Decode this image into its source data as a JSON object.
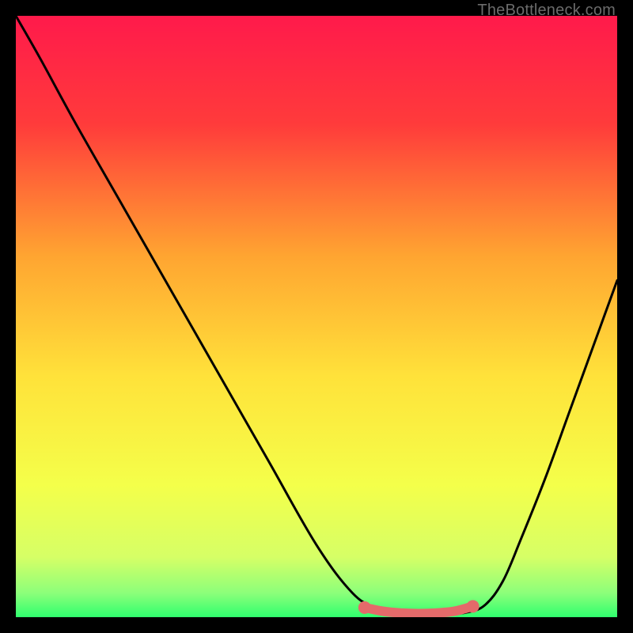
{
  "watermark": "TheBottleneck.com",
  "chart_data": {
    "type": "line",
    "title": "",
    "xlabel": "",
    "ylabel": "",
    "xlim": [
      0,
      100
    ],
    "ylim": [
      0,
      100
    ],
    "gradient_stops": [
      {
        "offset": 0,
        "color": "#ff1a4b"
      },
      {
        "offset": 18,
        "color": "#ff3b3b"
      },
      {
        "offset": 40,
        "color": "#ffa531"
      },
      {
        "offset": 60,
        "color": "#ffe23a"
      },
      {
        "offset": 78,
        "color": "#f4ff4a"
      },
      {
        "offset": 90,
        "color": "#d6ff66"
      },
      {
        "offset": 96,
        "color": "#8cff7a"
      },
      {
        "offset": 100,
        "color": "#2fff6e"
      }
    ],
    "series": [
      {
        "name": "bottleneck-curve",
        "x": [
          0,
          4,
          10,
          18,
          26,
          34,
          42,
          50,
          56,
          60,
          63,
          66,
          69,
          72,
          75,
          78,
          81,
          84,
          88,
          92,
          96,
          100
        ],
        "y": [
          100,
          93,
          82,
          68,
          54,
          40,
          26,
          12,
          4,
          1.5,
          0.8,
          0.5,
          0.4,
          0.5,
          0.8,
          2,
          6,
          13,
          23,
          34,
          45,
          56
        ]
      }
    ],
    "flat_segment": {
      "name": "plateau-marker",
      "color": "#e46a6a",
      "x": [
        58,
        61,
        64,
        67,
        70,
        73,
        76
      ],
      "y": [
        1.6,
        1.0,
        0.7,
        0.6,
        0.7,
        1.0,
        1.8
      ]
    }
  }
}
